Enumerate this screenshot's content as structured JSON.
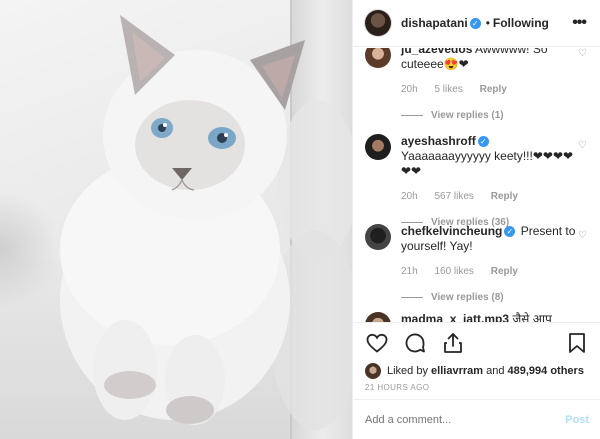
{
  "post": {
    "username": "dishapatani",
    "separator": "•",
    "follow_state": "Following",
    "more": "•••"
  },
  "comments": [
    {
      "user": "ju_azevedos",
      "text": "Awwwww! So cuteeee😍❤",
      "age": "20h",
      "likes": "5 likes",
      "reply": "Reply",
      "view_replies": "View replies (1)"
    },
    {
      "user": "ayeshashroff",
      "verified": true,
      "text": "Yaaaaaaayyyyyy keety!!!❤❤❤❤❤❤",
      "age": "20h",
      "likes": "567 likes",
      "reply": "Reply",
      "view_replies": "View replies (36)"
    },
    {
      "user": "chefkelvincheung",
      "verified": true,
      "text": "Present to yourself! Yay!",
      "age": "21h",
      "likes": "160 likes",
      "reply": "Reply",
      "view_replies": "View replies (8)"
    },
    {
      "user": "madma_x_jatt.mp3",
      "text": "जैसे आप बिल्ली"
    }
  ],
  "likes_line": {
    "prefix": "Liked by ",
    "user": "elliavrram",
    "middle": " and ",
    "count": "489,994 others"
  },
  "timestamp": "21 HOURS AGO",
  "add_comment": {
    "placeholder": "Add a comment...",
    "post_label": "Post"
  },
  "colors": {
    "verified": "#3897f0",
    "post_disabled": "#b2dffc",
    "muted": "#999999"
  }
}
